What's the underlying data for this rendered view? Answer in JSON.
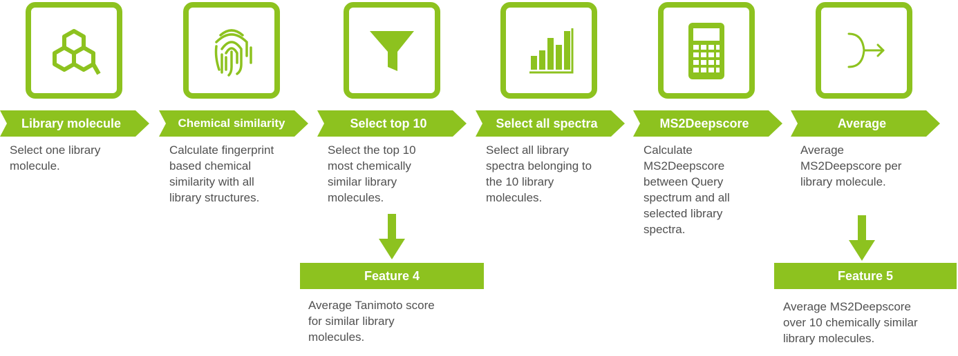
{
  "colors": {
    "accent": "#8DC21F",
    "text": "#505050",
    "banner_text": "#ffffff"
  },
  "steps": [
    {
      "title": "Library molecule",
      "icon": "molecule-icon",
      "description": [
        "Select one library",
        "molecule."
      ]
    },
    {
      "title": "Chemical similarity",
      "icon": "fingerprint-icon",
      "description": [
        "Calculate fingerprint",
        "based chemical",
        "similarity with all",
        "library structures."
      ]
    },
    {
      "title": "Select top 10",
      "icon": "funnel-icon",
      "description": [
        "Select the top 10",
        "most chemically",
        "similar library",
        "molecules."
      ]
    },
    {
      "title": "Select all spectra",
      "icon": "bar-chart-icon",
      "description": [
        "Select all library",
        "spectra belonging to",
        "the 10 library",
        "molecules."
      ]
    },
    {
      "title": "MS2Deepscore",
      "icon": "calculator-icon",
      "description": [
        "Calculate",
        "MS2Deepscore",
        "between Query",
        "spectrum and all",
        "selected library",
        "spectra."
      ]
    },
    {
      "title": "Average",
      "icon": "merge-arrow-icon",
      "description": [
        "Average",
        "MS2Deepscore per",
        "library molecule."
      ]
    }
  ],
  "features": [
    {
      "title": "Feature 4",
      "description": [
        "Average Tanimoto score",
        "for similar library",
        "molecules."
      ]
    },
    {
      "title": "Feature 5",
      "description": [
        "Average MS2Deepscore",
        "over 10 chemically similar",
        "library molecules."
      ]
    }
  ]
}
